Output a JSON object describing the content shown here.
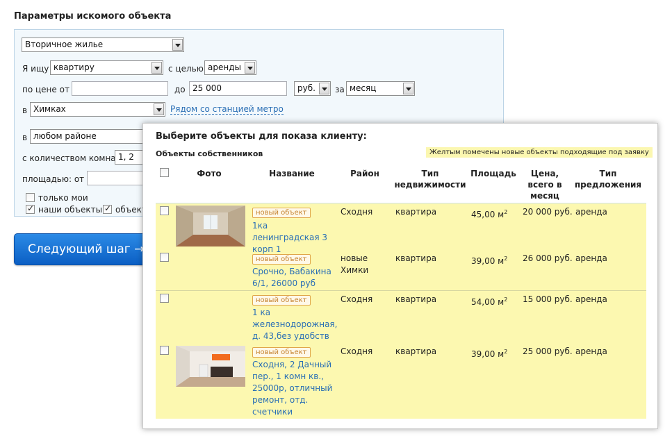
{
  "page": {
    "heading": "Параметры искомого объекта"
  },
  "form": {
    "property_type": "Вторичное жилье",
    "i_search_label": "Я ищу",
    "object_kind": "квартиру",
    "purpose_label": "с целью",
    "purpose": "аренды",
    "price_from_label": "по цене от",
    "price_from_value": "",
    "price_to_label": "до",
    "price_to_value": "25 000",
    "currency": "руб.",
    "per_label": "за",
    "period": "месяц",
    "in_label": "в",
    "city": "Химках",
    "metro_link": "Рядом со станцией метро",
    "district_in_label": "в",
    "district": "любом районе",
    "rooms_label": "с количеством комнат",
    "rooms_value": "1, 2",
    "area_label": "площадью: от",
    "only_mine_label": "только мои",
    "our_objects_label": "наши объекты",
    "objects_label_partial": "объект"
  },
  "next_button": {
    "label": "Следующий шаг →"
  },
  "popup": {
    "title": "Выберите объекты для показа клиенту:",
    "owners_label": "Объекты собственников",
    "legend_note": "Желтым помечены новые объекты подходящие под заявку",
    "columns": {
      "photo": "Фото",
      "name": "Название",
      "district": "Район",
      "type": "Тип недвижимости",
      "area": "Площадь",
      "price": "Цена, всего в месяц",
      "offer": "Тип предложения"
    },
    "rows": [
      {
        "badge": "новый объект",
        "name": "1ка ленинградская 3 корп 1",
        "district": "Сходня",
        "type": "квартира",
        "area": "45,00 м",
        "area_sup": "2",
        "price": "20 000 руб.",
        "offer": "аренда"
      },
      {
        "badge": "новый объект",
        "name": "Срочно, Бабакина 6/1, 26000 руб",
        "district": "новые Химки",
        "type": "квартира",
        "area": "39,00 м",
        "area_sup": "2",
        "price": "26 000 руб.",
        "offer": "аренда"
      },
      {
        "badge": "новый объект",
        "name": "1 ка железнодорожная, д. 43,без удобств",
        "district": "Сходня",
        "type": "квартира",
        "area": "54,00 м",
        "area_sup": "2",
        "price": "15 000 руб.",
        "offer": "аренда"
      },
      {
        "badge": "новый объект",
        "name": "Сходня, 2 Дачный пер., 1 комн кв., 25000р, отличный ремонт, отд. счетчики",
        "district": "Сходня",
        "type": "квартира",
        "area": "39,00 м",
        "area_sup": "2",
        "price": "25 000 руб.",
        "offer": "аренда"
      }
    ]
  }
}
